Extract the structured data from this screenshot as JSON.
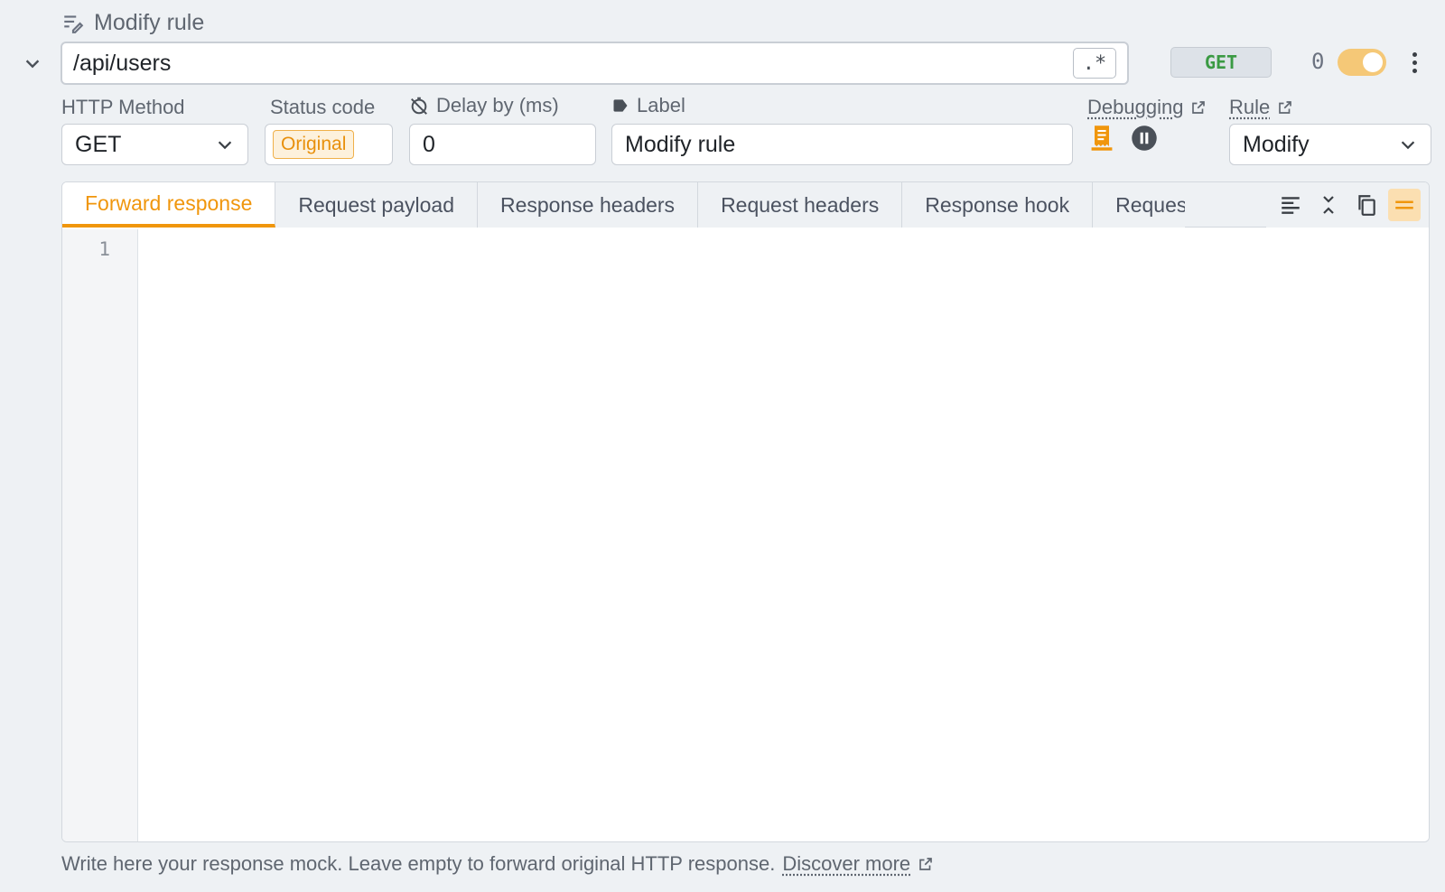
{
  "header": {
    "title": "Modify rule"
  },
  "rule": {
    "url_value": "/api/users",
    "regex_toggle_label": ".*",
    "method_badge": "GET",
    "hit_count": "0",
    "enabled": true
  },
  "fields": {
    "http_method": {
      "label": "HTTP Method",
      "value": "GET"
    },
    "status_code": {
      "label": "Status code",
      "value": "Original"
    },
    "delay": {
      "label": "Delay by (ms)",
      "value": "0"
    },
    "label": {
      "label": "Label",
      "value": "Modify rule"
    },
    "debugging": {
      "label": "Debugging"
    },
    "rule_type": {
      "label": "Rule",
      "value": "Modify"
    }
  },
  "editor": {
    "tabs": [
      {
        "label": "Forward response",
        "active": true
      },
      {
        "label": "Request payload"
      },
      {
        "label": "Response headers"
      },
      {
        "label": "Request headers"
      },
      {
        "label": "Response hook"
      },
      {
        "label": "Request hook"
      }
    ],
    "line_numbers": [
      "1"
    ]
  },
  "footer": {
    "hint": "Write here your response mock. Leave empty to forward original HTTP response.",
    "link": "Discover more"
  },
  "colors": {
    "accent": "#f0960c",
    "method_green": "#3a9a43",
    "toggle_on": "#f5c877",
    "background": "#eef1f4"
  },
  "icons": [
    "edit-rule-icon",
    "chevron-down-icon",
    "regex-icon",
    "kebab-menu-icon",
    "timer-off-icon",
    "tag-icon",
    "external-link-icon",
    "receipt-icon",
    "pause-icon",
    "align-left-icon",
    "collapse-icon",
    "copy-icon",
    "wrap-lines-icon"
  ]
}
